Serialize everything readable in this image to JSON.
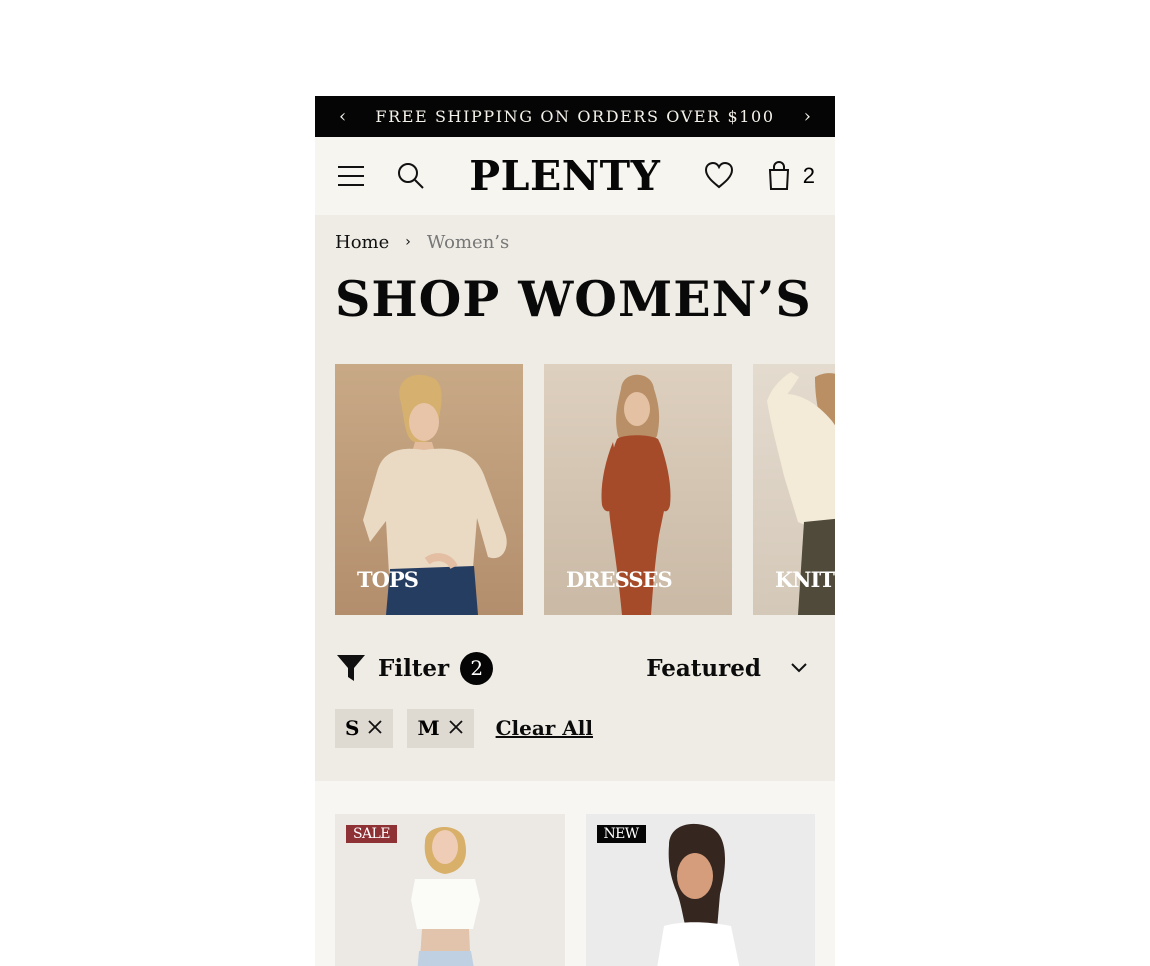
{
  "promo_bar": {
    "message": "FREE SHIPPING ON ORDERS OVER $100",
    "prev_icon": "chevron-left-icon",
    "next_icon": "chevron-right-icon"
  },
  "header": {
    "logo": "PLENTY",
    "cart_count": "2",
    "icons": [
      "menu-icon",
      "search-icon",
      "heart-icon",
      "shopping-bag-icon"
    ]
  },
  "breadcrumb": {
    "home": "Home",
    "current": "Women’s"
  },
  "page_title": "SHOP WOMEN’S",
  "categories": [
    {
      "label": "TOPS"
    },
    {
      "label": "DRESSES"
    },
    {
      "label": "KNITWEAR"
    }
  ],
  "filter_bar": {
    "label": "Filter",
    "count": "2",
    "sort_label": "Featured"
  },
  "active_filters": [
    {
      "label": "S"
    },
    {
      "label": "M"
    }
  ],
  "clear_all": "Clear All",
  "products": [
    {
      "tag": "SALE",
      "tag_color": "#8f3236"
    },
    {
      "tag": "NEW",
      "tag_color": "#050505"
    }
  ],
  "colors": {
    "promo_bg": "#050505",
    "page_bg": "#efece5",
    "header_bg": "#f7f5f0",
    "chip_bg": "#dedad2",
    "sale_tag": "#8f3236"
  }
}
